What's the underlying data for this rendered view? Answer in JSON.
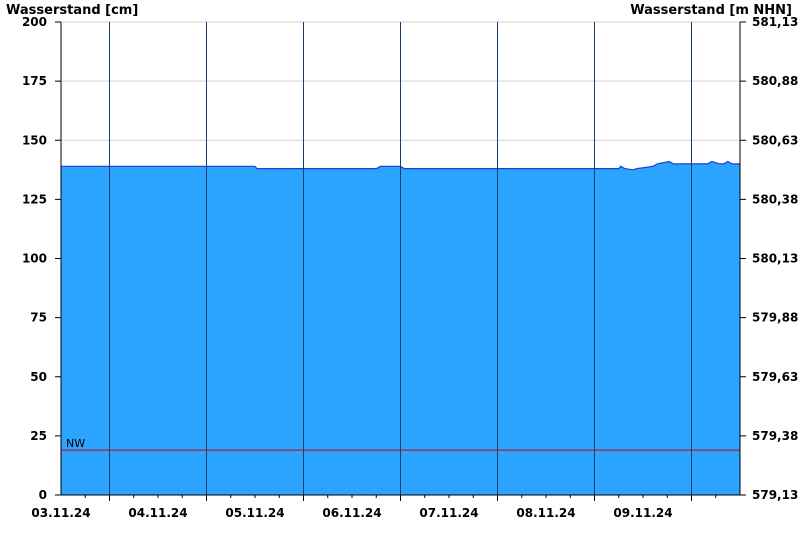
{
  "chart_data": {
    "type": "area",
    "ylabel_left": "Wasserstand [cm]",
    "ylabel_right": "Wasserstand [m NHN]",
    "ylim": [
      0,
      200
    ],
    "yticks_left": [
      0,
      25,
      50,
      75,
      100,
      125,
      150,
      175,
      200
    ],
    "yticks_right": [
      "579,13",
      "579,38",
      "579,63",
      "579,88",
      "580,13",
      "580,38",
      "580,63",
      "580,88",
      "581,13"
    ],
    "x_start": "2024-11-02T12:00",
    "x_end": "2024-11-09T12:00",
    "day_labels": [
      "03.11.24",
      "04.11.24",
      "05.11.24",
      "06.11.24",
      "07.11.24",
      "08.11.24",
      "09.11.24"
    ],
    "grid": true,
    "fill_color": "#2aa4ff",
    "line_color": "#1c3fd6",
    "nw": {
      "label": "NW",
      "value": 19,
      "color": "#d00000"
    },
    "series": [
      {
        "x": [
          "2024-11-02T12:00",
          "2024-11-03T12:00",
          "2024-11-04T12:00",
          "2024-11-04T12:30",
          "2024-11-05T12:00",
          "2024-11-05T18:00",
          "2024-11-05T19:00",
          "2024-11-06T00:00",
          "2024-11-06T01:00",
          "2024-11-07T00:00",
          "2024-11-08T06:00",
          "2024-11-08T06:30",
          "2024-11-08T07:30",
          "2024-11-08T09:30",
          "2024-11-08T10:30",
          "2024-11-08T14:30",
          "2024-11-08T15:30",
          "2024-11-08T18:30",
          "2024-11-08T19:30",
          "2024-11-08T23:30",
          "2024-11-09T00:00",
          "2024-11-09T04:00",
          "2024-11-09T05:00",
          "2024-11-09T07:00",
          "2024-11-09T08:00",
          "2024-11-09T09:00",
          "2024-11-09T10:00",
          "2024-11-09T12:00"
        ],
        "y": [
          139,
          139,
          139,
          138,
          138,
          138,
          139,
          139,
          138,
          138,
          138,
          139,
          138,
          137.5,
          138,
          139,
          140,
          141,
          140,
          140,
          140,
          140,
          141,
          140,
          140,
          141,
          140,
          140
        ]
      }
    ]
  }
}
